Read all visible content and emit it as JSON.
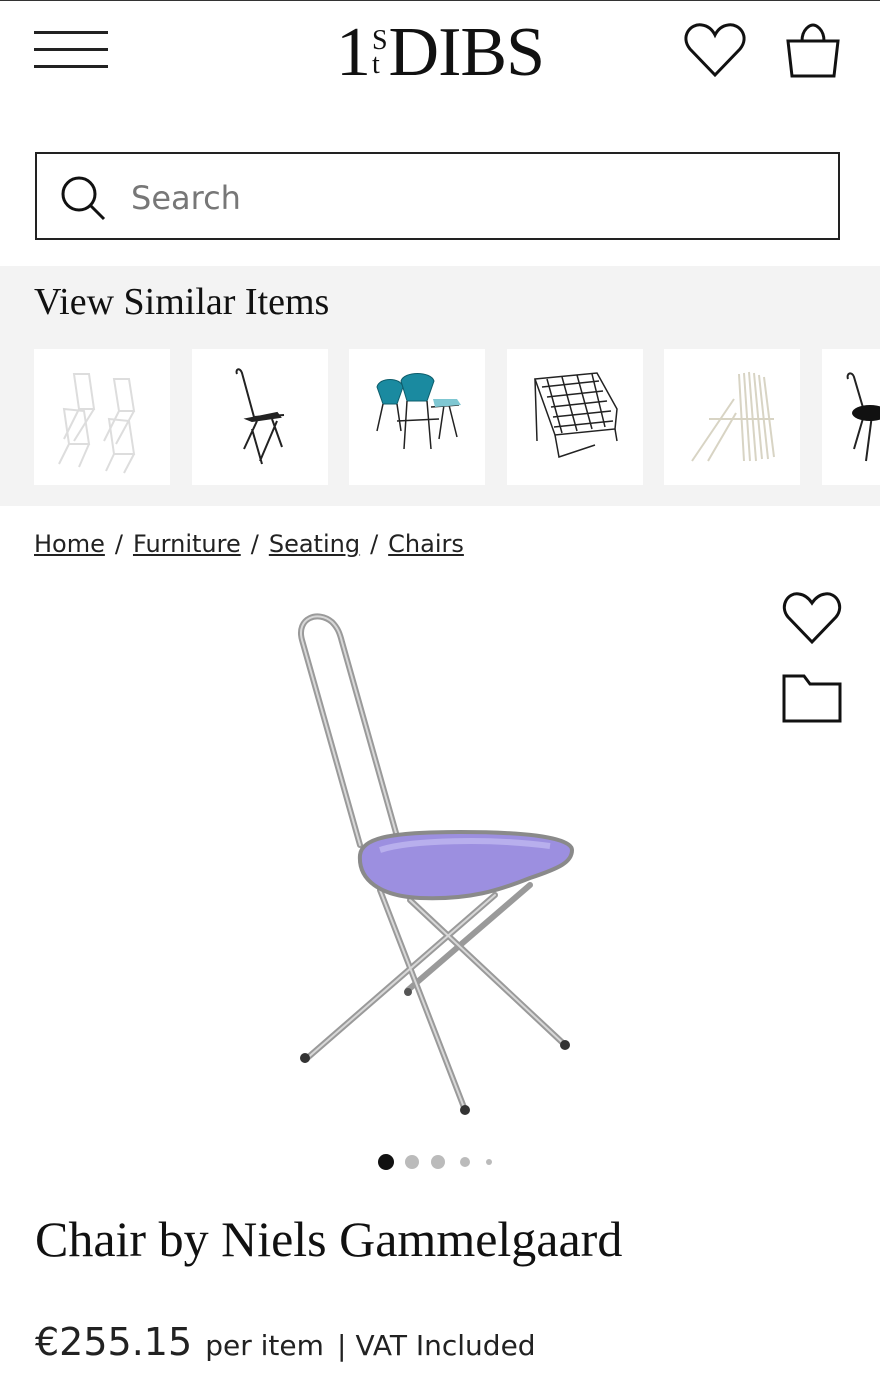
{
  "header": {
    "logo_main": "DIBS",
    "logo_num": "1",
    "logo_s": "S",
    "logo_t": "t"
  },
  "search": {
    "placeholder": "Search"
  },
  "similar": {
    "title": "View Similar Items",
    "items": [
      "white-folding-chairs-set",
      "black-wire-chair",
      "teal-chairs-and-table",
      "wire-lounge-chair",
      "white-folding-chairs-stack",
      "black-wire-chair-partial"
    ]
  },
  "breadcrumb": {
    "items": [
      "Home",
      "Furniture",
      "Seating",
      "Chairs"
    ],
    "separator": "/"
  },
  "product": {
    "title": "Chair by Niels Gammelgaard",
    "price": "€255.15",
    "per_item": "per item",
    "divider": "|",
    "vat": "VAT Included",
    "image_count": 5,
    "active_image": 1
  },
  "colors": {
    "text": "#222222",
    "similar_bg": "#f3f3f3",
    "seat": "#9c8fe0"
  }
}
